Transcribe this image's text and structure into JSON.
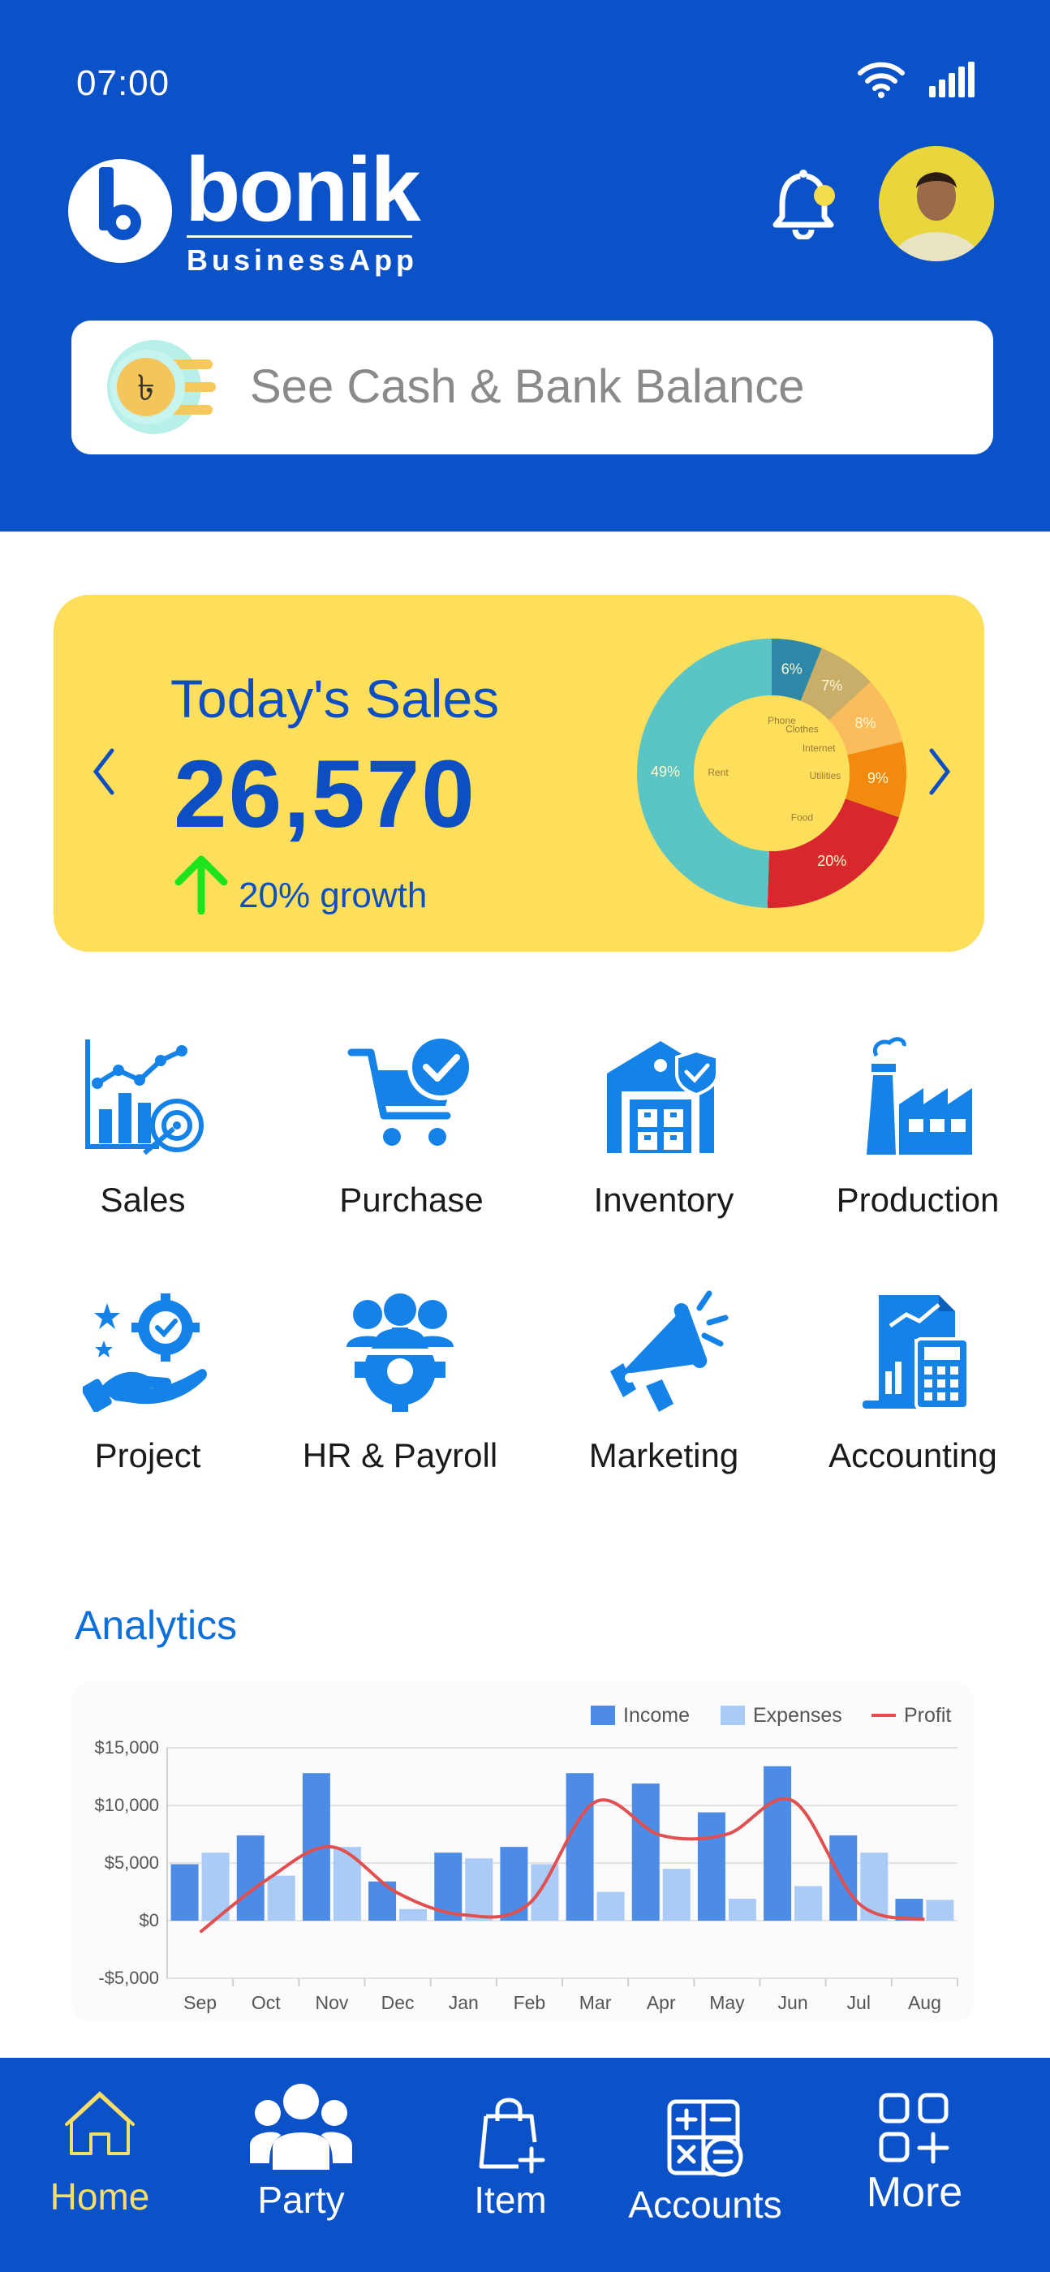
{
  "status_bar": {
    "time": "07:00"
  },
  "brand": {
    "name": "bonik",
    "subtitle": "BusinessApp"
  },
  "balance": {
    "label": "See Cash & Bank Balance"
  },
  "sales_card": {
    "title": "Today's Sales",
    "value": "26,570",
    "growth": "20% growth"
  },
  "modules": [
    {
      "label": "Sales",
      "icon": "sales-chart-icon"
    },
    {
      "label": "Purchase",
      "icon": "cart-check-icon"
    },
    {
      "label": "Inventory",
      "icon": "warehouse-icon"
    },
    {
      "label": "Production",
      "icon": "factory-icon"
    },
    {
      "label": "Project",
      "icon": "hand-gear-icon"
    },
    {
      "label": "HR & Payroll",
      "icon": "team-gear-icon"
    },
    {
      "label": "Marketing",
      "icon": "megaphone-icon"
    },
    {
      "label": "Accounting",
      "icon": "calculator-report-icon"
    }
  ],
  "analytics": {
    "title": "Analytics"
  },
  "nav": [
    {
      "label": "Home",
      "active": true
    },
    {
      "label": "Party"
    },
    {
      "label": "Item"
    },
    {
      "label": "Accounts"
    },
    {
      "label": "More"
    }
  ],
  "colors": {
    "brand_blue": "#0b51c8",
    "card_yellow": "#fedf5b",
    "income": "#4d8ce6",
    "expenses": "#abcbf7",
    "profit": "#e05050",
    "active_nav": "#f7de6a"
  },
  "chart_data": [
    {
      "type": "pie",
      "style": "donut",
      "labels": [
        "Phone",
        "Clothes",
        "Internet",
        "Utilities",
        "Food",
        "Rent"
      ],
      "values": [
        6,
        7,
        8,
        9,
        20,
        49
      ],
      "value_labels": [
        "6%",
        "7%",
        "8%",
        "9%",
        "20%",
        "49%"
      ],
      "colors": [
        "#2f88a8",
        "#c9ae6a",
        "#fbbd5c",
        "#f28a0f",
        "#d9272e",
        "#5bc4c4"
      ]
    },
    {
      "type": "bar",
      "categories": [
        "Sep",
        "Oct",
        "Nov",
        "Dec",
        "Jan",
        "Feb",
        "Mar",
        "Apr",
        "May",
        "Jun",
        "Jul",
        "Aug"
      ],
      "series": [
        {
          "name": "Income",
          "type": "bar",
          "values": [
            4900,
            7400,
            12800,
            3400,
            5900,
            6400,
            12800,
            11900,
            9400,
            13400,
            7400,
            1900
          ]
        },
        {
          "name": "Expenses",
          "type": "bar",
          "values": [
            5900,
            3900,
            6400,
            1000,
            5400,
            4900,
            2500,
            4500,
            1900,
            3000,
            5900,
            1800
          ]
        },
        {
          "name": "Profit",
          "type": "line",
          "values": [
            -1000,
            3500,
            6400,
            2400,
            500,
            1500,
            10300,
            7400,
            7500,
            10400,
            1500,
            100
          ]
        }
      ],
      "y_ticks": [
        "$15,000",
        "$10,000",
        "$5,000",
        "$0",
        "-$5,000"
      ],
      "ylim": [
        -5000,
        15000
      ],
      "legend": "top-right",
      "grid": true
    }
  ]
}
